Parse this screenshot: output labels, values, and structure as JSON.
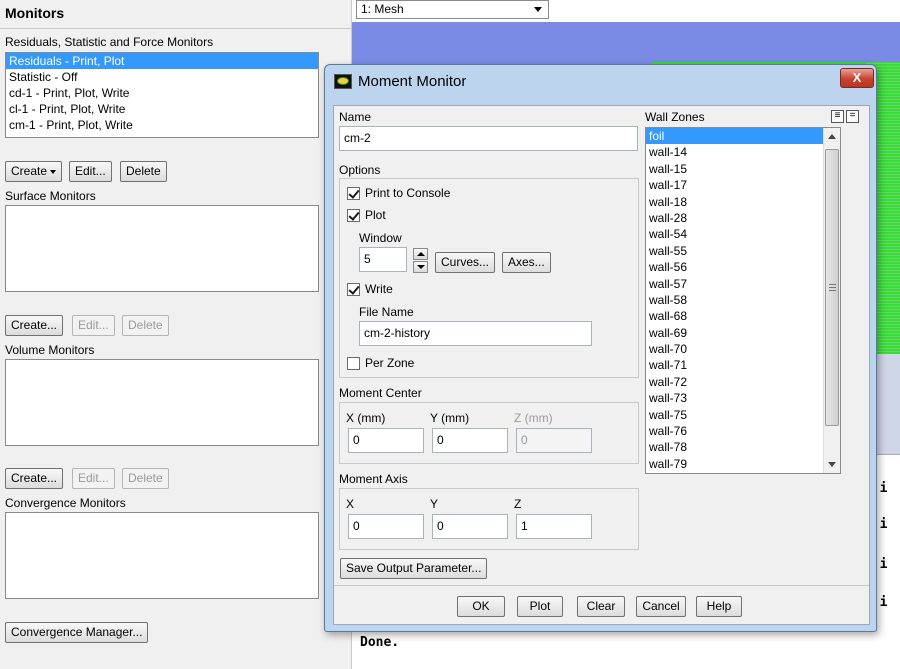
{
  "monitors_panel": {
    "title": "Monitors",
    "residuals_section": {
      "label": "Residuals, Statistic and Force Monitors",
      "items": [
        "Residuals - Print, Plot",
        "Statistic - Off",
        "cd-1 - Print, Plot, Write",
        "cl-1 - Print, Plot, Write",
        "cm-1 - Print, Plot, Write"
      ],
      "selected_index": 0,
      "create_label": "Create",
      "edit_label": "Edit...",
      "delete_label": "Delete"
    },
    "surface_section": {
      "label": "Surface Monitors",
      "create_label": "Create...",
      "edit_label": "Edit...",
      "delete_label": "Delete"
    },
    "volume_section": {
      "label": "Volume Monitors",
      "create_label": "Create...",
      "edit_label": "Edit...",
      "delete_label": "Delete"
    },
    "convergence_section": {
      "label": "Convergence Monitors"
    },
    "convergence_manager_label": "Convergence Manager..."
  },
  "graphics": {
    "view_selector": "1: Mesh",
    "console_fragment": "g i",
    "console_done": "Done."
  },
  "dialog": {
    "title": "Moment Monitor",
    "close_label": "X",
    "name_label": "Name",
    "name_value": "cm-2",
    "options_label": "Options",
    "print_to_console": {
      "label": "Print to Console",
      "checked": true
    },
    "plot": {
      "label": "Plot",
      "checked": true
    },
    "window_label": "Window",
    "window_value": "5",
    "curves_label": "Curves...",
    "axes_label": "Axes...",
    "write": {
      "label": "Write",
      "checked": true
    },
    "file_name_label": "File Name",
    "file_name_value": "cm-2-history",
    "per_zone": {
      "label": "Per Zone",
      "checked": false
    },
    "moment_center": {
      "label": "Moment Center",
      "x_label": "X (mm)",
      "x_value": "0",
      "y_label": "Y (mm)",
      "y_value": "0",
      "z_label": "Z (mm)",
      "z_value": "0"
    },
    "moment_axis": {
      "label": "Moment Axis",
      "x_label": "X",
      "x_value": "0",
      "y_label": "Y",
      "y_value": "0",
      "z_label": "Z",
      "z_value": "1"
    },
    "save_output_label": "Save Output Parameter...",
    "wall_zones": {
      "label": "Wall Zones",
      "items": [
        "foil",
        "wall-14",
        "wall-15",
        "wall-17",
        "wall-18",
        "wall-28",
        "wall-54",
        "wall-55",
        "wall-56",
        "wall-57",
        "wall-58",
        "wall-68",
        "wall-69",
        "wall-70",
        "wall-71",
        "wall-72",
        "wall-73",
        "wall-75",
        "wall-76",
        "wall-78",
        "wall-79"
      ],
      "selected_index": 0
    },
    "buttons": {
      "ok": "OK",
      "plot": "Plot",
      "clear": "Clear",
      "cancel": "Cancel",
      "help": "Help"
    }
  }
}
